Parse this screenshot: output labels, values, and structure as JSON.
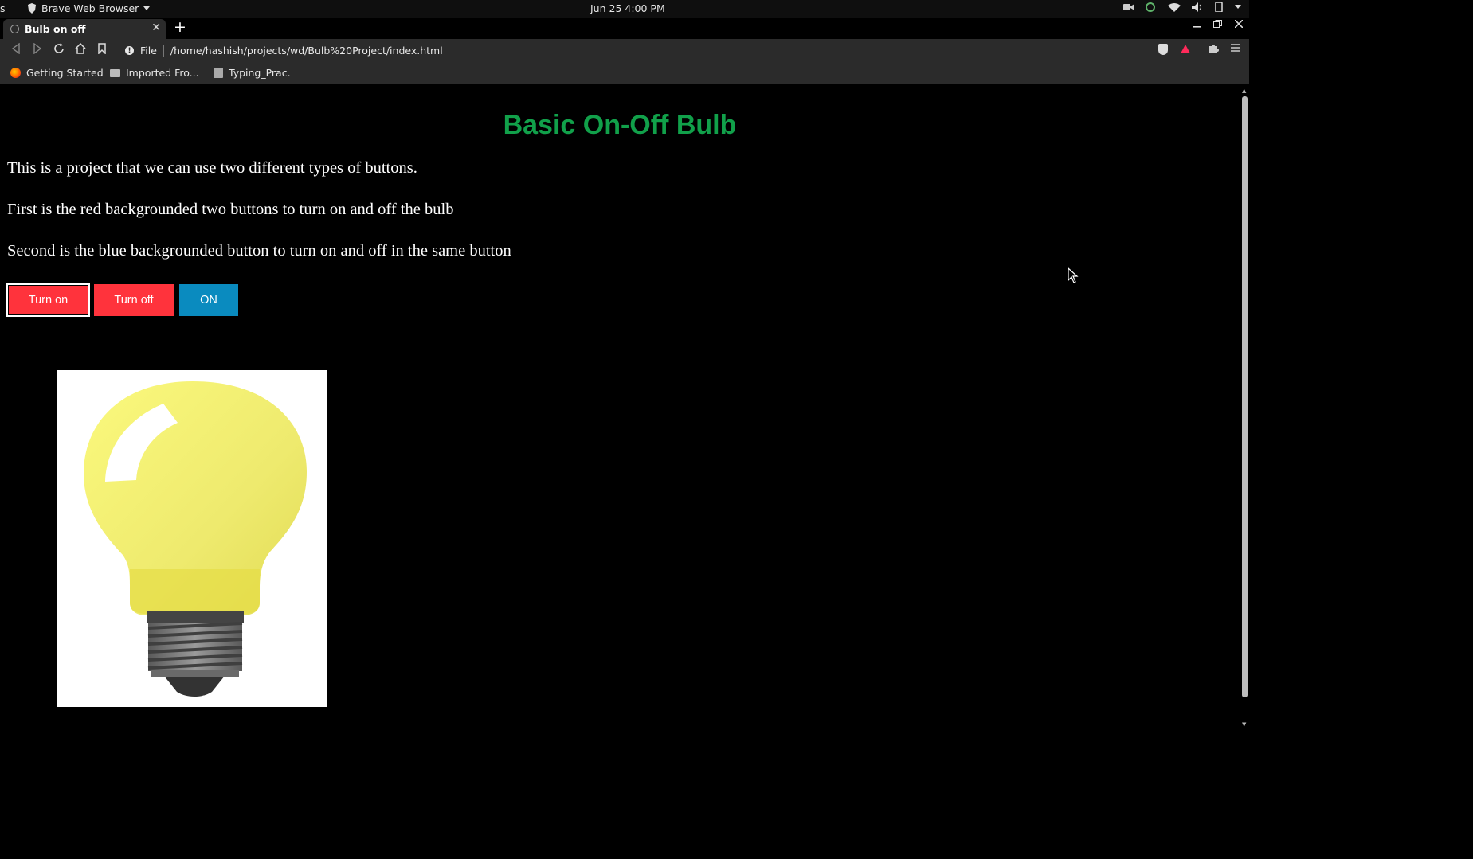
{
  "system_bar": {
    "edge_glyph": "s",
    "app_name": "Brave Web Browser",
    "clock": "Jun 25   4:00 PM"
  },
  "tab": {
    "title": "Bulb on off",
    "close": "✕",
    "new_tab": "+"
  },
  "address_bar": {
    "scheme_label": "File",
    "url": "/home/hashish/projects/wd/Bulb%20Project/index.html"
  },
  "bookmarks": [
    {
      "label": "Getting Started",
      "icon": "firefox-icon"
    },
    {
      "label": "Imported Fro...",
      "icon": "folder-icon"
    },
    {
      "label": "Typing_Prac.",
      "icon": "page-icon"
    }
  ],
  "page": {
    "heading": "Basic On-Off Bulb",
    "paragraphs": [
      "This is a project that we can use two different types of buttons.",
      "First is the red backgrounded two buttons to turn on and off the bulb",
      "Second is the blue backgrounded button to turn on and off in the same button"
    ],
    "buttons": {
      "turn_on": "Turn on",
      "turn_off": "Turn off",
      "toggle": "ON"
    },
    "bulb_state": "on"
  },
  "colors": {
    "heading": "#11a04a",
    "red_button": "#ff333c",
    "blue_button": "#0a8bbf",
    "bulb_glass": "#f2ef72"
  }
}
